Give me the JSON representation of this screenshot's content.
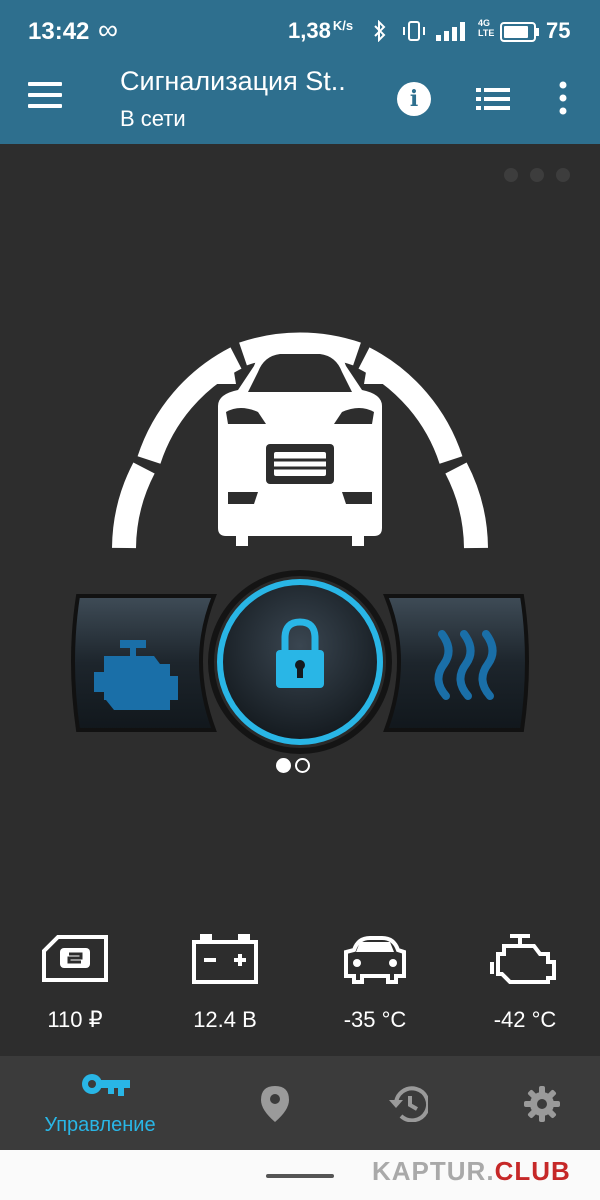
{
  "status_bar": {
    "time": "13:42",
    "speed": "1,38",
    "speed_unit": "K/s",
    "battery": "75",
    "network": "4G LTE"
  },
  "app_bar": {
    "title": "Сигнализация St..",
    "subtitle": "В сети"
  },
  "controls": {
    "left_button_icon": "engine-start-icon",
    "center_button_icon": "lock-icon",
    "right_button_icon": "heater-icon"
  },
  "stats": [
    {
      "icon": "balance-card-icon",
      "value": "110 ₽"
    },
    {
      "icon": "car-battery-icon",
      "value": "12.4 В"
    },
    {
      "icon": "car-cabin-temp-icon",
      "value": "-35 °C"
    },
    {
      "icon": "engine-temp-icon",
      "value": "-42 °C"
    }
  ],
  "bottom_nav": {
    "items": [
      {
        "icon": "key-icon",
        "label": "Управление",
        "active": true
      },
      {
        "icon": "location-pin-icon",
        "label": "",
        "active": false
      },
      {
        "icon": "history-icon",
        "label": "",
        "active": false
      },
      {
        "icon": "settings-gear-icon",
        "label": "",
        "active": false
      }
    ]
  },
  "watermark": {
    "part1": "KAPTUR.",
    "part2": "CLUB"
  },
  "colors": {
    "header": "#2e6f8e",
    "accent": "#29b6e6",
    "background": "#2d2d2d",
    "nav_background": "#3b3b3b"
  }
}
